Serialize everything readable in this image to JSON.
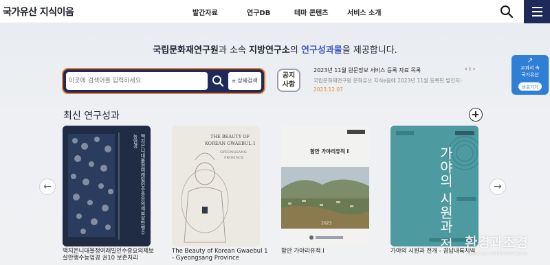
{
  "header": {
    "logo": "국가유산 지식이음",
    "nav": [
      "발간자료",
      "연구DB",
      "테마 콘텐츠",
      "서비스 소개"
    ]
  },
  "hero": {
    "tagline_part1": "국립문화재연구원",
    "tagline_part2": "과 소속 ",
    "tagline_part3": "지방연구소",
    "tagline_part4": "의 ",
    "tagline_highlight": "연구성과물",
    "tagline_part5": "을 제공합니다."
  },
  "search": {
    "placeholder": "이곳에 검색어를 입력하세요.",
    "detail_label": "상세검색"
  },
  "notice": {
    "badge_line1": "공지",
    "badge_line2": "사항",
    "title": "2023년 11월 원문정보 서비스 등록 자료 목록",
    "desc": "국립문화재연구원 문화유산 지식e음에 2023년 11월 등록된 발간자료 ...",
    "date": "2023.12.07",
    "arrows": "‹ ı ›"
  },
  "side_banner": {
    "arrow": "↗",
    "line1": "교과서 속",
    "line2": "국가유산",
    "go_label": "바로가기"
  },
  "section": {
    "title": "최신 연구성과"
  },
  "books": [
    {
      "caption": "백지은니대불정여래밀인수증요의제보살만행수능엄경 권10 보존처리",
      "color": "#1f2c44"
    },
    {
      "caption": "The Beauty of Korean Gwaebul 1 - Gyeongsang Province",
      "color": "#ece9e2"
    },
    {
      "caption": "함안 가야리유적 I",
      "color": "#f2f2f0"
    },
    {
      "caption": "가야의 시원과 전개 - 경남내륙지역",
      "color": "#4d9aa1"
    }
  ],
  "book_covers": {
    "book1_title": "백지은니대불정여래밀인수증요의제보살만행수능엄경",
    "book2_title1": "THE BEAUTY OF",
    "book2_title2": "KOREAN GWAEBUL 1",
    "book2_sub1": "GYEONGSANG",
    "book2_sub2": "PROVINCE",
    "book3_title": "함안 가야리유적 I",
    "book3_year": "2023",
    "book4_title": "가야의 시원과 전개"
  },
  "watermark": {
    "text": "환경과조경",
    "sub": "landscape architecture korea"
  },
  "colors": {
    "navy": "#1f2a5a",
    "accent_blue": "#3b56c4",
    "orange": "#e87a2a",
    "banner_blue": "#2f7fd6"
  }
}
